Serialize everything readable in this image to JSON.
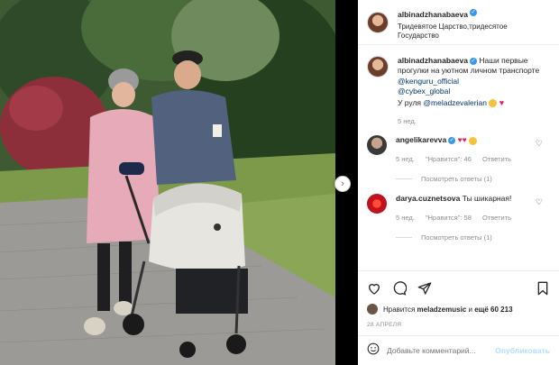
{
  "post": {
    "username": "albinadzhanabaeva",
    "location": "Тридевятое Царство,тридесятое Государство"
  },
  "caption": {
    "username": "albinadzhanabaeva",
    "text": "Наши первые прогулки на уютном личном транспорте",
    "mention1": "@kenguru_official",
    "mention2": "@cybex_global",
    "line_prefix": "У руля",
    "mention3": "@meladzevalerian",
    "time": "5 нед."
  },
  "comments": [
    {
      "username": "angelikarevva",
      "time": "5 нед.",
      "likes": "\"Нравится\": 46",
      "reply": "Ответить",
      "view_replies": "Посмотреть ответы (1)"
    },
    {
      "username": "darya.cuznetsova",
      "text": "Ты шикарная!",
      "time": "5 нед.",
      "likes": "\"Нравится\": 58",
      "reply": "Ответить",
      "view_replies": "Посмотреть ответы (1)"
    }
  ],
  "likes": {
    "prefix": "Нравится",
    "user": "meladzemusic",
    "connector": "и",
    "others": "ещё 60 213"
  },
  "date": "28 АПРЕЛЯ",
  "comment_box": {
    "placeholder": "Добавьте комментарий...",
    "publish": "Опубликовать"
  },
  "colors": {
    "link": "#00376b",
    "verified": "#3897f0",
    "muted": "#8e8e8e",
    "publish_disabled": "#b2dffc"
  },
  "icons": [
    "heart-icon",
    "comment-icon",
    "share-icon",
    "bookmark-icon",
    "emoji-icon",
    "chevron-right-icon"
  ]
}
